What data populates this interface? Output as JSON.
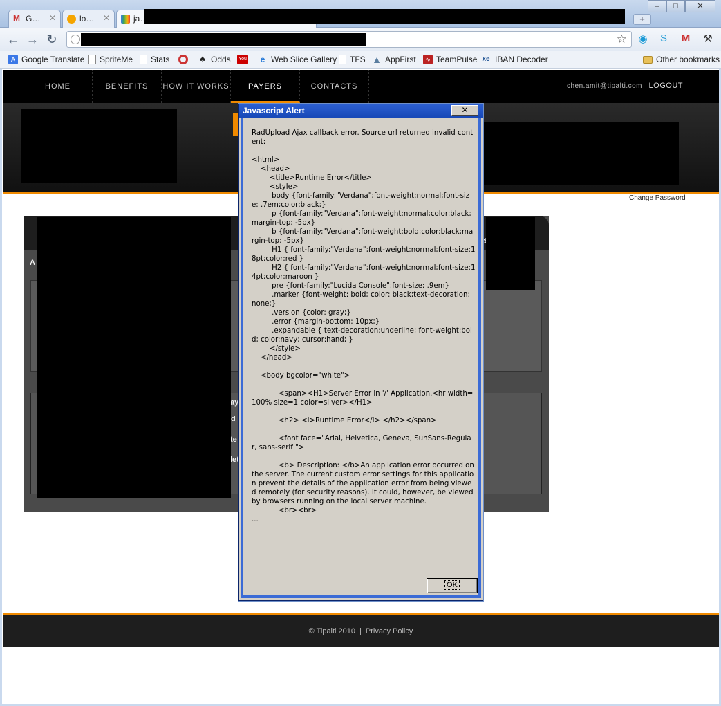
{
  "browser": {
    "tabs": [
      {
        "label": "G…",
        "icon": "gmail-icon"
      },
      {
        "label": "lo…",
        "icon": "orange-circle-icon"
      },
      {
        "label": "ja…",
        "icon": "google-icon"
      }
    ],
    "new_tab_label": "+",
    "window_buttons": {
      "minimize": "–",
      "maximize": "□",
      "close": "✕"
    },
    "nav": {
      "back": "←",
      "forward": "→",
      "reload": "↻"
    },
    "star": "☆",
    "bookmarks": [
      {
        "label": "Google Translate",
        "icon": "translate-icon"
      },
      {
        "label": "SpriteMe",
        "icon": "page-icon"
      },
      {
        "label": "Stats",
        "icon": "page-icon"
      },
      {
        "label": "",
        "icon": "lifebuoy-icon"
      },
      {
        "label": "Odds",
        "icon": "spade-icon"
      },
      {
        "label": "",
        "icon": "youtube-icon"
      },
      {
        "label": "Web Slice Gallery",
        "icon": "ie-icon"
      },
      {
        "label": "TFS",
        "icon": "page-icon"
      },
      {
        "label": "AppFirst",
        "icon": "appfirst-icon"
      },
      {
        "label": "TeamPulse",
        "icon": "teampulse-icon"
      },
      {
        "label": "IBAN Decoder",
        "icon": "xe-icon"
      }
    ],
    "other_bookmarks": "Other bookmarks"
  },
  "site": {
    "nav": [
      "HOME",
      "BENEFITS",
      "HOW IT WORKS",
      "PAYERS",
      "CONTACTS"
    ],
    "active_nav": "PAYERS",
    "user_email": "chen.amit@tipalti.com",
    "logout": "LOGOUT",
    "change_password": "Change Password",
    "fragments": [
      "A",
      "d",
      "ay",
      "d",
      "te",
      "let"
    ],
    "footer_copyright": "© Tipalti 2010",
    "footer_sep": "|",
    "footer_privacy": "Privacy Policy",
    "accent_color": "#f08a00"
  },
  "dialog": {
    "title": "Javascript Alert",
    "close": "✕",
    "message": "RadUpload Ajax callback error. Source url returned invalid content:\n\n<html>\n    <head>\n        <title>Runtime Error</title>\n        <style>\n         body {font-family:\"Verdana\";font-weight:normal;font-size: .7em;color:black;}\n         p {font-family:\"Verdana\";font-weight:normal;color:black;margin-top: -5px}\n         b {font-family:\"Verdana\";font-weight:bold;color:black;margin-top: -5px}\n         H1 { font-family:\"Verdana\";font-weight:normal;font-size:18pt;color:red }\n         H2 { font-family:\"Verdana\";font-weight:normal;font-size:14pt;color:maroon }\n         pre {font-family:\"Lucida Console\";font-size: .9em}\n         .marker {font-weight: bold; color: black;text-decoration: none;}\n         .version {color: gray;}\n         .error {margin-bottom: 10px;}\n         .expandable { text-decoration:underline; font-weight:bold; color:navy; cursor:hand; }\n        </style>\n    </head>\n\n    <body bgcolor=\"white\">\n\n            <span><H1>Server Error in '/' Application.<hr width=100% size=1 color=silver></H1>\n\n            <h2> <i>Runtime Error</i> </h2></span>\n\n            <font face=\"Arial, Helvetica, Geneva, SunSans-Regular, sans-serif \">\n\n            <b> Description: </b>An application error occurred on the server. The current custom error settings for this application prevent the details of the application error from being viewed remotely (for security reasons). It could, however, be viewed by browsers running on the local server machine.\n            <br><br>\n...",
    "ok": "OK"
  }
}
